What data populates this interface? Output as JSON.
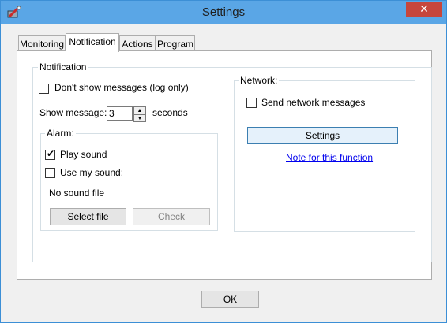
{
  "window": {
    "title": "Settings",
    "close_label": "✕"
  },
  "tabs": [
    "Monitoring",
    "Notification",
    "Actions",
    "Program"
  ],
  "notification": {
    "group_label": "Notification",
    "dont_show_label": "Don't show messages (log only)",
    "show_message_label": "Show message:",
    "show_message_value": "3",
    "seconds_label": "seconds",
    "alarm": {
      "group_label": "Alarm:",
      "play_sound_label": "Play sound",
      "play_sound_checked": true,
      "use_my_sound_label": "Use my sound:",
      "use_my_sound_checked": false,
      "sound_file_text": "No sound file",
      "select_file_label": "Select file",
      "check_label": "Check"
    }
  },
  "network": {
    "group_label": "Network:",
    "send_label": "Send network messages",
    "send_checked": false,
    "settings_label": "Settings",
    "note_link": "Note for this function"
  },
  "footer": {
    "ok_label": "OK"
  }
}
